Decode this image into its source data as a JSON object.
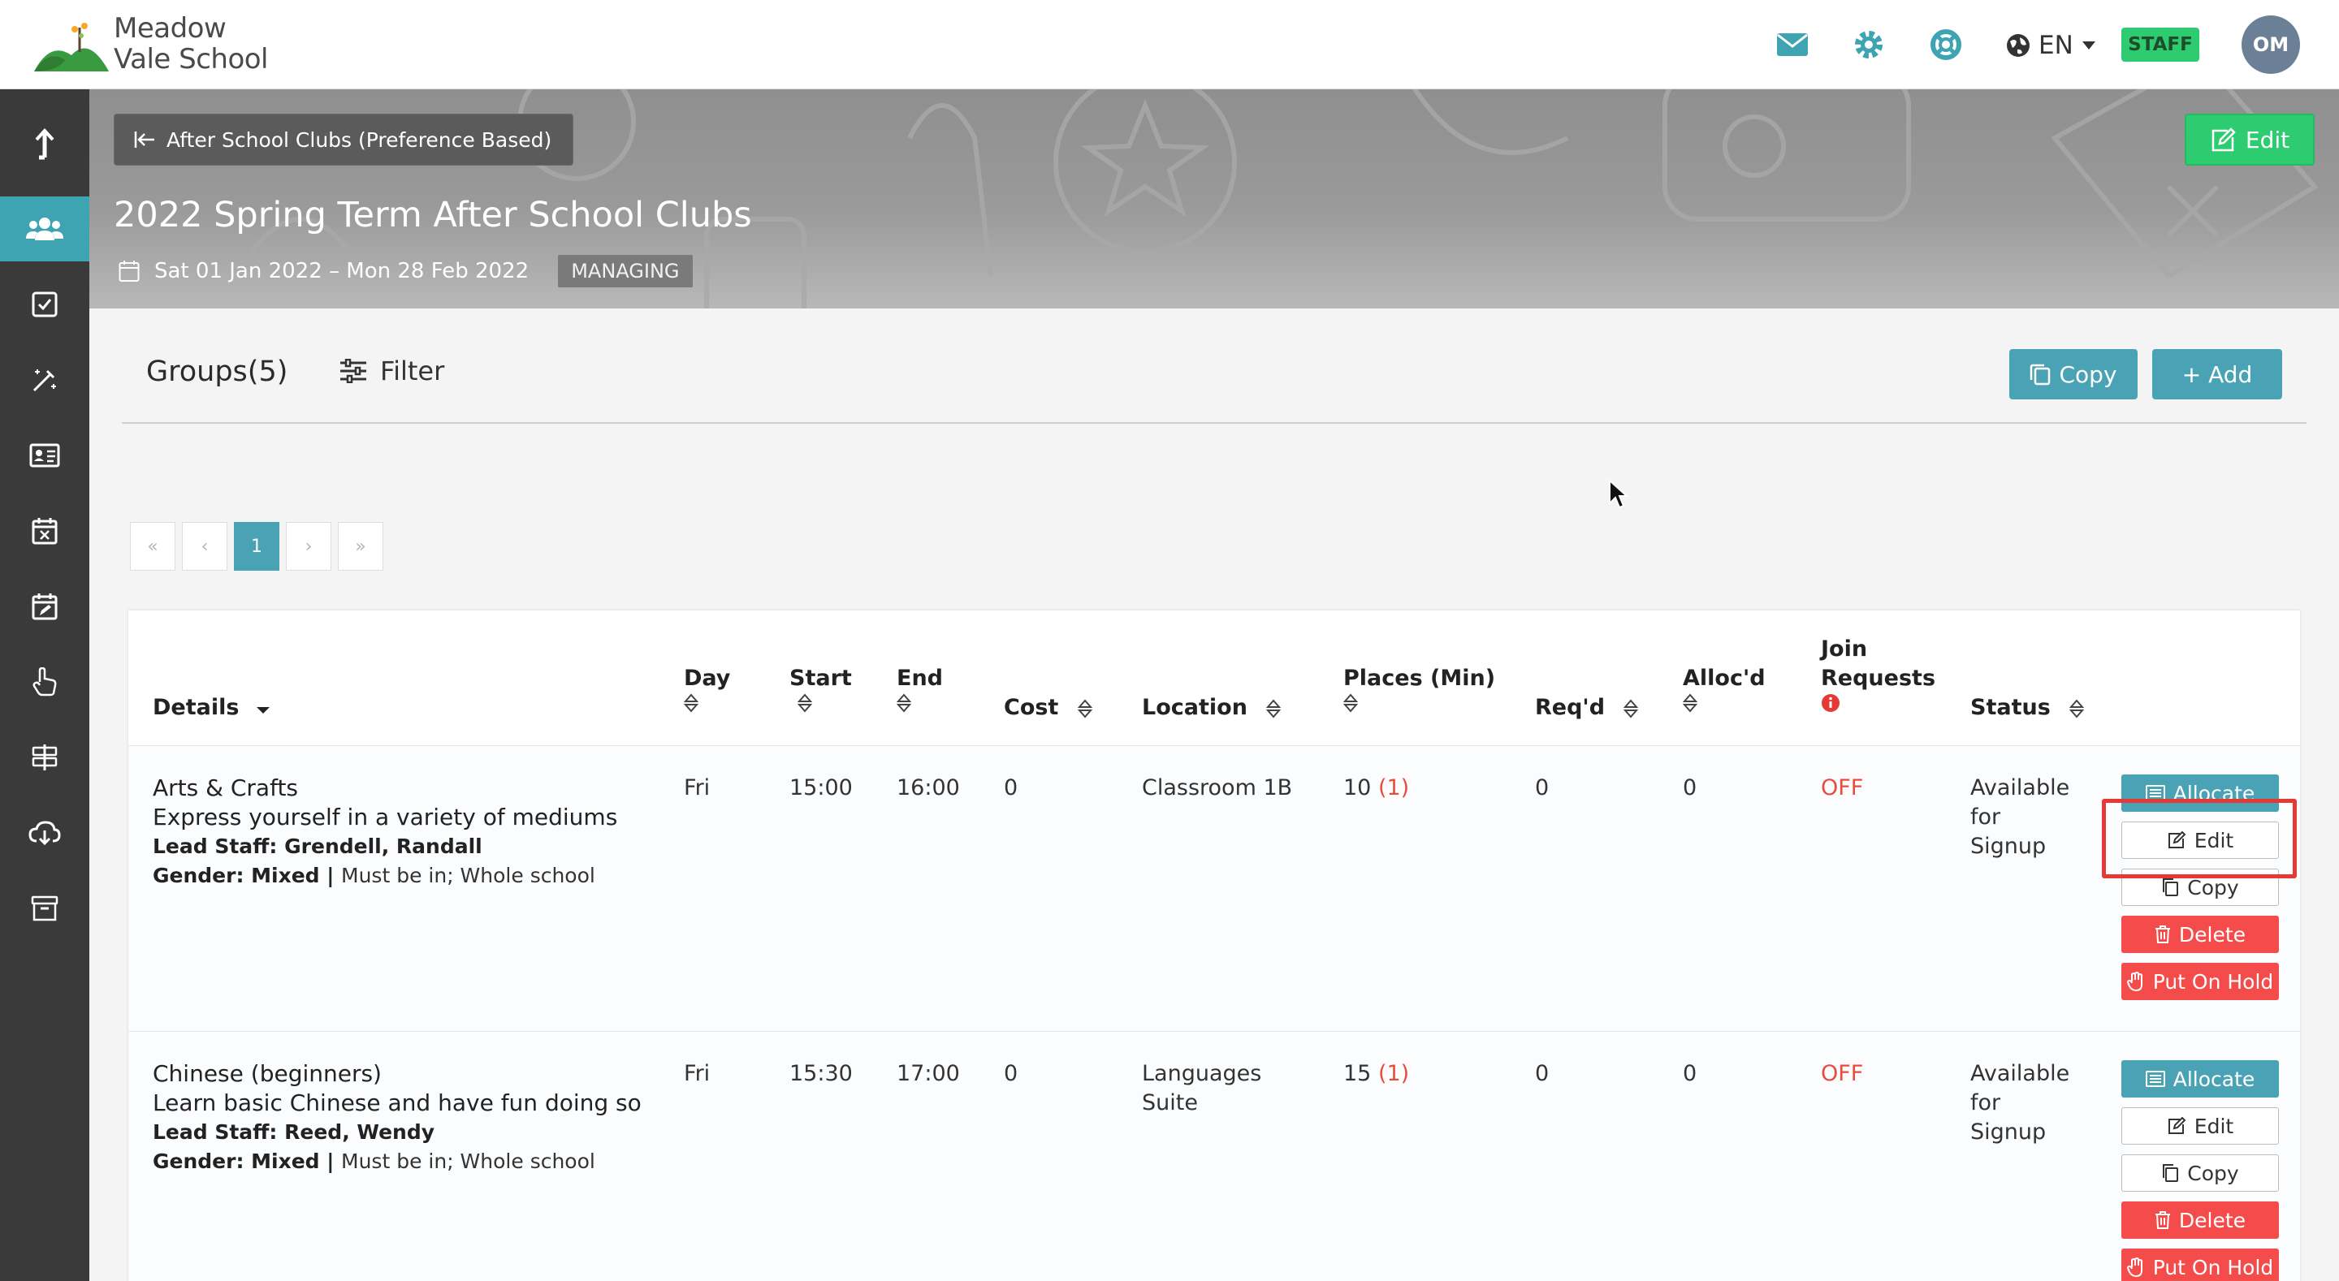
{
  "school": {
    "name_line1": "Meadow",
    "name_line2": "Vale School"
  },
  "topbar": {
    "language": "EN",
    "role_badge": "STAFF",
    "avatar_initials": "OM",
    "icons": [
      "mail-icon",
      "gear-icon",
      "lifebuoy-icon",
      "globe-icon"
    ]
  },
  "sidebar": {
    "items": [
      "upload-icon",
      "users-icon",
      "checkbox-icon",
      "magic-wand-icon",
      "id-card-icon",
      "calendar-x-icon",
      "calendar-edit-icon",
      "hand-pointer-icon",
      "signpost-icon",
      "cloud-download-icon",
      "archive-icon"
    ],
    "active_index": 1
  },
  "header": {
    "back_label": "After School Clubs (Preference Based)",
    "edit_label": "Edit",
    "title": "2022 Spring Term After School Clubs",
    "date_range": "Sat 01 Jan 2022 – Mon 28 Feb 2022",
    "status_tag": "MANAGING"
  },
  "toolbar": {
    "groups_title": "Groups(5)",
    "filter_label": "Filter",
    "copy_label": "Copy",
    "add_label": "+ Add"
  },
  "pagination": {
    "first": "«",
    "prev": "‹",
    "current": "1",
    "next": "›",
    "last": "»"
  },
  "table": {
    "headers": {
      "details": "Details",
      "day": "Day",
      "start": "Start",
      "end": "End",
      "cost": "Cost",
      "location": "Location",
      "places": "Places (Min)",
      "reqd": "Req'd",
      "allocd": "Alloc'd",
      "join_line1": "Join",
      "join_line2": "Requests",
      "status": "Status"
    },
    "rows": [
      {
        "name": "Arts & Crafts",
        "description": "Express yourself in a variety of mediums",
        "lead_staff": "Lead Staff: Grendell, Randall",
        "gender": "Gender: Mixed |",
        "eligibility": "Must be in; Whole school",
        "day": "Fri",
        "start": "15:00",
        "end": "16:00",
        "cost": "0",
        "location_line1": "Classroom 1B",
        "location_line2": "",
        "places": "10",
        "places_min": "(1)",
        "reqd": "0",
        "allocd": "0",
        "join_requests": "OFF",
        "status_line1": "Available",
        "status_line2": "for",
        "status_line3": "Signup"
      },
      {
        "name": "Chinese (beginners)",
        "description": "Learn basic Chinese and have fun doing so",
        "lead_staff": "Lead Staff: Reed, Wendy",
        "gender": "Gender: Mixed |",
        "eligibility": "Must be in; Whole school",
        "day": "Fri",
        "start": "15:30",
        "end": "17:00",
        "cost": "0",
        "location_line1": "Languages",
        "location_line2": "Suite",
        "places": "15",
        "places_min": "(1)",
        "reqd": "0",
        "allocd": "0",
        "join_requests": "OFF",
        "status_line1": "Available",
        "status_line2": "for",
        "status_line3": "Signup"
      }
    ],
    "actions": {
      "allocate": "Allocate",
      "edit": "Edit",
      "copy": "Copy",
      "delete": "Delete",
      "hold": "Put On Hold"
    }
  },
  "colors": {
    "accent_teal": "#4aa3b5",
    "success_green": "#2ecc71",
    "danger_red": "#f44b4b",
    "sidebar_dark": "#3a3a3a",
    "highlight_red": "#e53935"
  }
}
